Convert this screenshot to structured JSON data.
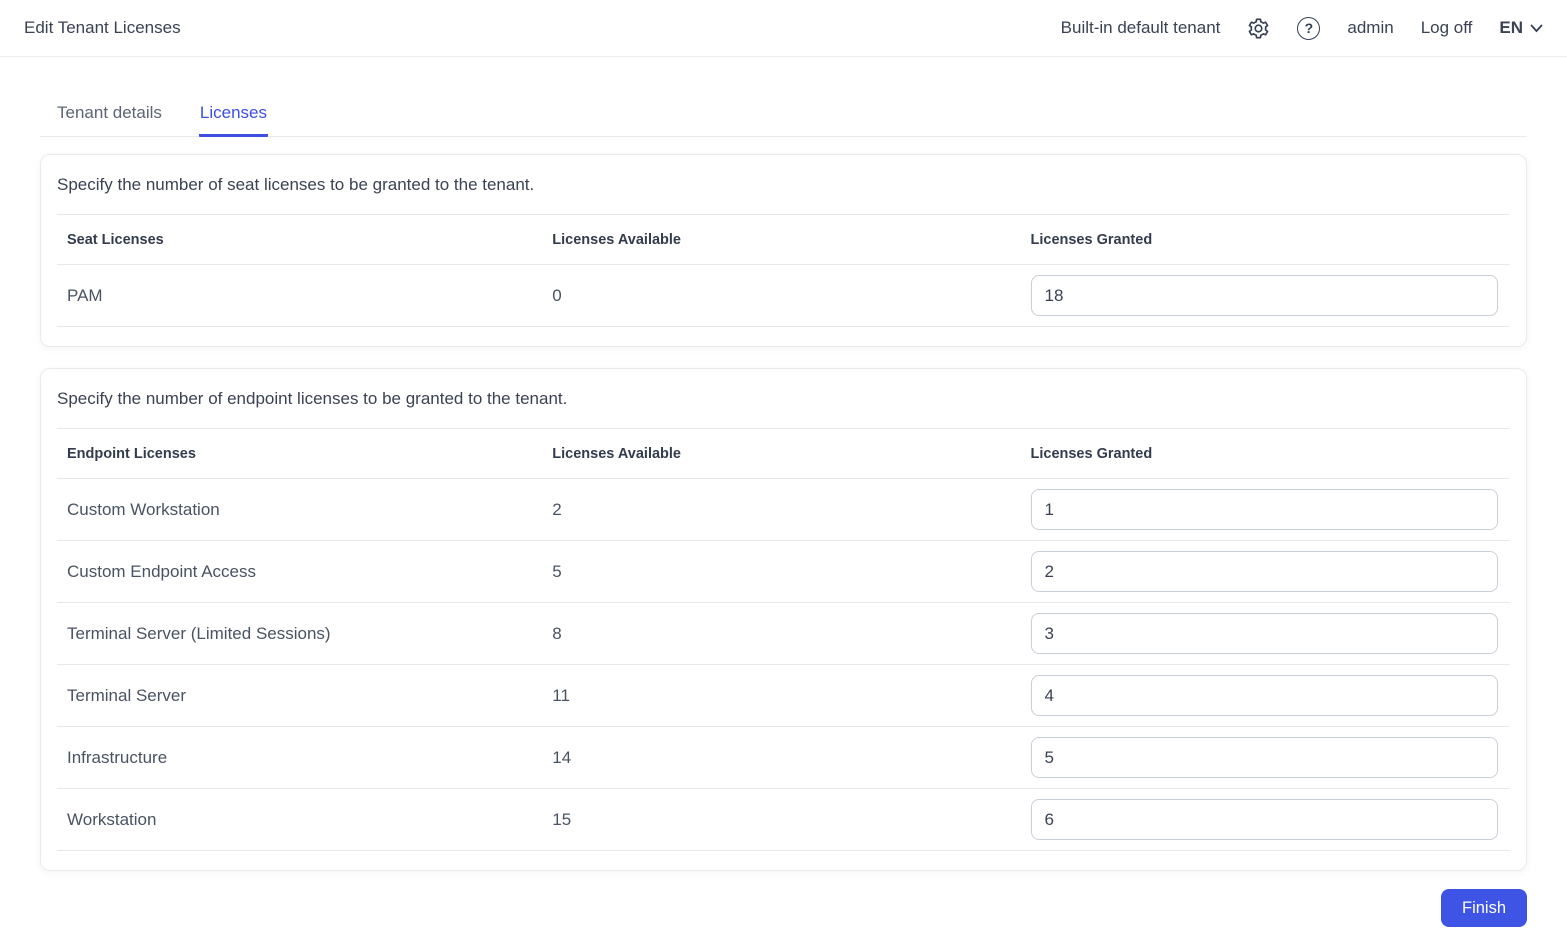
{
  "header": {
    "title": "Edit Tenant Licenses",
    "tenant_name": "Built-in default tenant",
    "settings_icon": "gear-icon",
    "help_icon": "help-icon",
    "username": "admin",
    "logoff_label": "Log off",
    "language": "EN",
    "language_chevron": "chevron-down-icon"
  },
  "tabs": [
    {
      "label": "Tenant details",
      "active": false
    },
    {
      "label": "Licenses",
      "active": true
    }
  ],
  "seat_section": {
    "description": "Specify the number of seat licenses to be granted to the tenant.",
    "columns": [
      "Seat Licenses",
      "Licenses Available",
      "Licenses Granted"
    ],
    "rows": [
      {
        "name": "PAM",
        "available": "0",
        "granted": "18"
      }
    ]
  },
  "endpoint_section": {
    "description": "Specify the number of endpoint licenses to be granted to the tenant.",
    "columns": [
      "Endpoint Licenses",
      "Licenses Available",
      "Licenses Granted"
    ],
    "rows": [
      {
        "name": "Custom Workstation",
        "available": "2",
        "granted": "1"
      },
      {
        "name": "Custom Endpoint Access",
        "available": "5",
        "granted": "2"
      },
      {
        "name": "Terminal Server (Limited Sessions)",
        "available": "8",
        "granted": "3"
      },
      {
        "name": "Terminal Server",
        "available": "11",
        "granted": "4"
      },
      {
        "name": "Infrastructure",
        "available": "14",
        "granted": "5"
      },
      {
        "name": "Workstation",
        "available": "15",
        "granted": "6"
      }
    ]
  },
  "footer": {
    "finish_label": "Finish"
  },
  "colors": {
    "accent": "#3d4fe1",
    "button": "#3d54e4",
    "text": "#3a4254",
    "divider": "#e7e8ec"
  }
}
